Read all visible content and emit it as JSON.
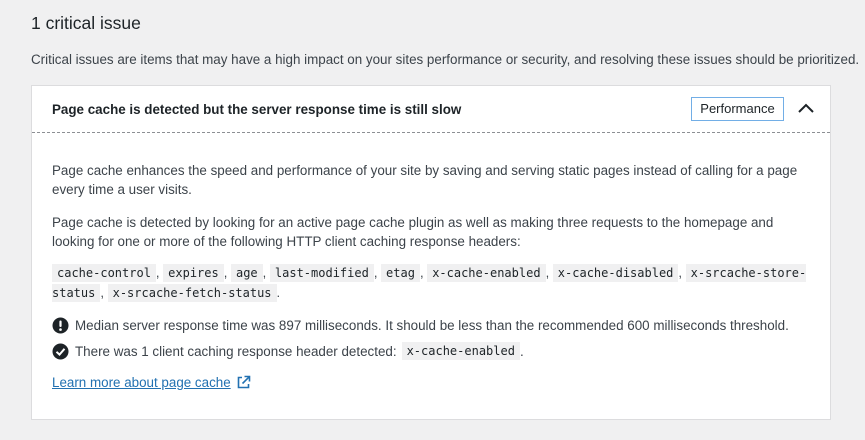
{
  "section": {
    "title": "1 critical issue",
    "description": "Critical issues are items that may have a high impact on your sites performance or security, and resolving these issues should be prioritized."
  },
  "issue": {
    "title": "Page cache is detected but the server response time is still slow",
    "badge": "Performance",
    "paragraph1": "Page cache enhances the speed and performance of your site by saving and serving static pages instead of calling for a page every time a user visits.",
    "paragraph2": "Page cache is detected by looking for an active page cache plugin as well as making three requests to the homepage and looking for one or more of the following HTTP client caching response headers:",
    "headers": [
      "cache-control",
      "expires",
      "age",
      "last-modified",
      "etag",
      "x-cache-enabled",
      "x-cache-disabled",
      "x-srcache-store-status",
      "x-srcache-fetch-status"
    ],
    "results": [
      {
        "icon": "exclamation-circle-icon",
        "text": "Median server response time was 897 milliseconds. It should be less than the recommended 600 milliseconds threshold."
      },
      {
        "icon": "check-circle-icon",
        "text": "There was 1 client caching response header detected:",
        "code": "x-cache-enabled",
        "suffix": "."
      }
    ],
    "link": {
      "label": "Learn more about page cache",
      "icon": "external-link-icon"
    }
  },
  "colors": {
    "background": "#f0f0f1",
    "panel": "#ffffff",
    "badge_border": "#72aee6",
    "link": "#2271b1",
    "text": "#1d2327"
  }
}
